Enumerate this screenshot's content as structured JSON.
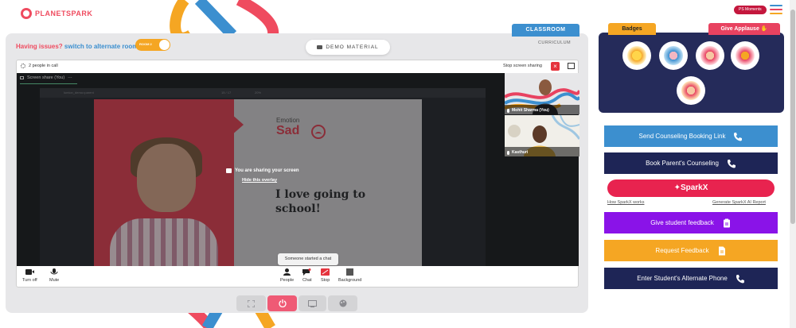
{
  "header": {
    "logo_text": "PLANETSPARK",
    "ps_moments_label": "PS Moments",
    "menu_colors": [
      "#3c8fcf",
      "#e84260",
      "#f5a623"
    ]
  },
  "left": {
    "issues_text": "Having issues?",
    "alt_room_link": "switch to alternate room",
    "room_toggle_label": "ROOM 2",
    "demo_material_label": "DEMO MATERIAL",
    "classroom_tab": "CLASSROOM",
    "curriculum_tab": "CURRICULUM"
  },
  "call": {
    "people_in_call": "2 people in call",
    "stop_sharing_label": "Stop screen sharing",
    "screen_share_label": "Screen share (You)",
    "shared_doc_title": "lumion_demo=parent",
    "shared_page": "15 / 17",
    "shared_zoom": "20%",
    "slide": {
      "emotion_label": "Emotion",
      "emotion": "Sad",
      "sentence": "I love going to school!"
    },
    "overlay_text": "You are sharing your screen",
    "overlay_link": "Hide this overlay",
    "participants": [
      {
        "name": "Mohit Sharma (You)"
      },
      {
        "name": "Kasthuri"
      }
    ],
    "toast": "Someone started a chat",
    "controls": {
      "turn_off": "Turn off",
      "mute": "Mute",
      "people": "People",
      "chat": "Chat",
      "stop": "Stop",
      "background": "Background"
    }
  },
  "right": {
    "badges_tab": "Badges",
    "applause_tab": "Give Applause",
    "buttons": {
      "counseling_link": "Send Counseling Booking Link",
      "parent_counseling": "Book Parent's Counseling",
      "sparkx": "SparkX",
      "how_sparkx": "How SparkX works",
      "generate_report": "Generate SparkX AI Report",
      "student_feedback": "Give student feedback",
      "request_feedback": "Request Feedback",
      "alternate_phone": "Enter Student's Alternate Phone"
    },
    "colors": {
      "card_bg": "#252b5a",
      "blue": "#3c8fcf",
      "navy": "#1e2556",
      "purple": "#8a13e8",
      "yellow": "#f5a623",
      "pink": "#e8234f"
    }
  }
}
